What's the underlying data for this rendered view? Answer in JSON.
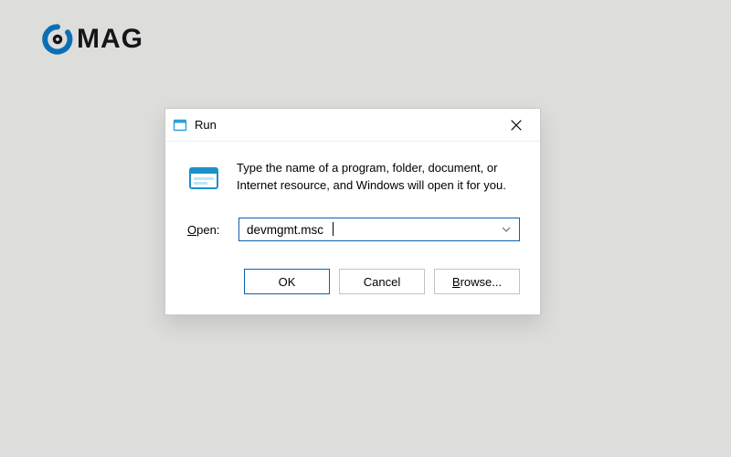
{
  "logo": {
    "text": "MAG"
  },
  "dialog": {
    "title": "Run",
    "description": "Type the name of a program, folder, document, or Internet resource, and Windows will open it for you.",
    "open_label_underline": "O",
    "open_label_rest": "pen:",
    "open_value": "devmgmt.msc",
    "buttons": {
      "ok": "OK",
      "cancel": "Cancel",
      "browse_underline": "B",
      "browse_rest": "rowse..."
    }
  }
}
